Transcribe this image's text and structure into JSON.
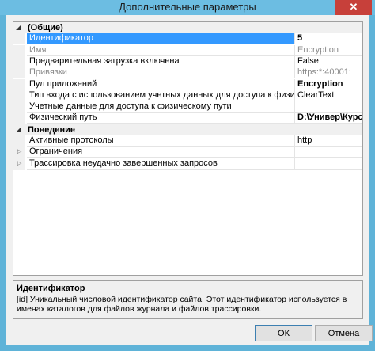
{
  "window": {
    "title": "Дополнительные параметры",
    "close_label": "✕"
  },
  "grid": {
    "categories": [
      {
        "label": "(Общие)",
        "properties": [
          {
            "name": "Идентификатор",
            "value": "5",
            "selected": true,
            "disabled": false,
            "bold": true
          },
          {
            "name": "Имя",
            "value": "Encryption",
            "selected": false,
            "disabled": true,
            "bold": false
          },
          {
            "name": "Предварительная загрузка включена",
            "value": "False",
            "selected": false,
            "disabled": false,
            "bold": false
          },
          {
            "name": "Привязки",
            "value": "https:*:40001:",
            "selected": false,
            "disabled": true,
            "bold": false
          },
          {
            "name": "Пул приложений",
            "value": "Encryption",
            "selected": false,
            "disabled": false,
            "bold": true
          },
          {
            "name": "Тип входа с использованием учетных данных для доступа к физическому пути",
            "value": "ClearText",
            "selected": false,
            "disabled": false,
            "bold": false
          },
          {
            "name": "Учетные данные для доступа к физическому пути",
            "value": "",
            "selected": false,
            "disabled": false,
            "bold": false
          },
          {
            "name": "Физический путь",
            "value": "D:\\Универ\\Курсач Г",
            "selected": false,
            "disabled": false,
            "bold": true
          }
        ]
      },
      {
        "label": "Поведение",
        "properties": [
          {
            "name": "Активные протоколы",
            "value": "http",
            "selected": false,
            "disabled": false,
            "bold": false,
            "expandable": false
          },
          {
            "name": "Ограничения",
            "value": "",
            "selected": false,
            "disabled": false,
            "bold": false,
            "expandable": true
          },
          {
            "name": "Трассировка неудачно завершенных запросов",
            "value": "",
            "selected": false,
            "disabled": false,
            "bold": false,
            "expandable": true
          }
        ]
      }
    ]
  },
  "description": {
    "title": "Идентификатор",
    "text": "[id] Уникальный числовой идентификатор сайта. Этот идентификатор используется в именах каталогов для файлов журнала и файлов трассировки."
  },
  "buttons": {
    "ok": "ОК",
    "cancel": "Отмена"
  }
}
